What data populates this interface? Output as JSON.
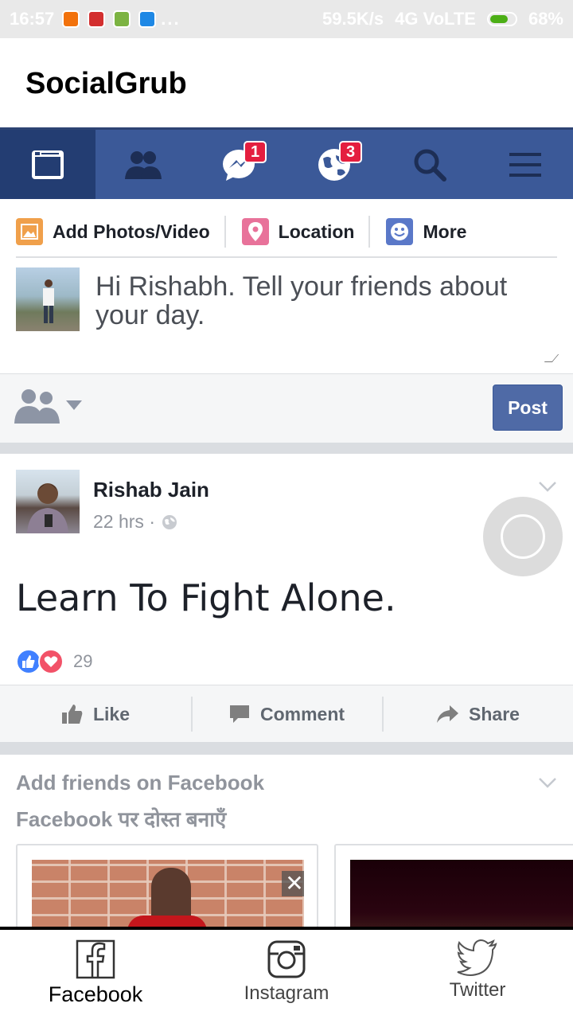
{
  "status_bar": {
    "time": "16:57",
    "net_speed": "59.5K/s",
    "network": "4G VoLTE",
    "battery": "68%"
  },
  "app": {
    "title": "SocialGrub"
  },
  "fb_nav": {
    "messages_badge": "1",
    "notifications_badge": "3"
  },
  "composer": {
    "actions": [
      "Add Photos/Video",
      "Location",
      "More"
    ],
    "placeholder": "Hi Rishabh. Tell your friends about your day.",
    "post_label": "Post"
  },
  "story": {
    "author": "Rishab Jain",
    "time": "22 hrs ·",
    "text": "Learn To Fight Alone.",
    "reaction_count": "29",
    "actions": [
      "Like",
      "Comment",
      "Share"
    ]
  },
  "pymk": {
    "title": "Add friends on Facebook",
    "subtitle": "Facebook पर दोस्त बनाएँ",
    "close_label": "✕"
  },
  "tabs": [
    "Facebook",
    "Instagram",
    "Twitter"
  ],
  "colors": {
    "fb_blue": "#3b5998",
    "fb_blue_active": "#233d72",
    "badge_red": "#e41e3f",
    "post_button": "#4f6aa6"
  }
}
